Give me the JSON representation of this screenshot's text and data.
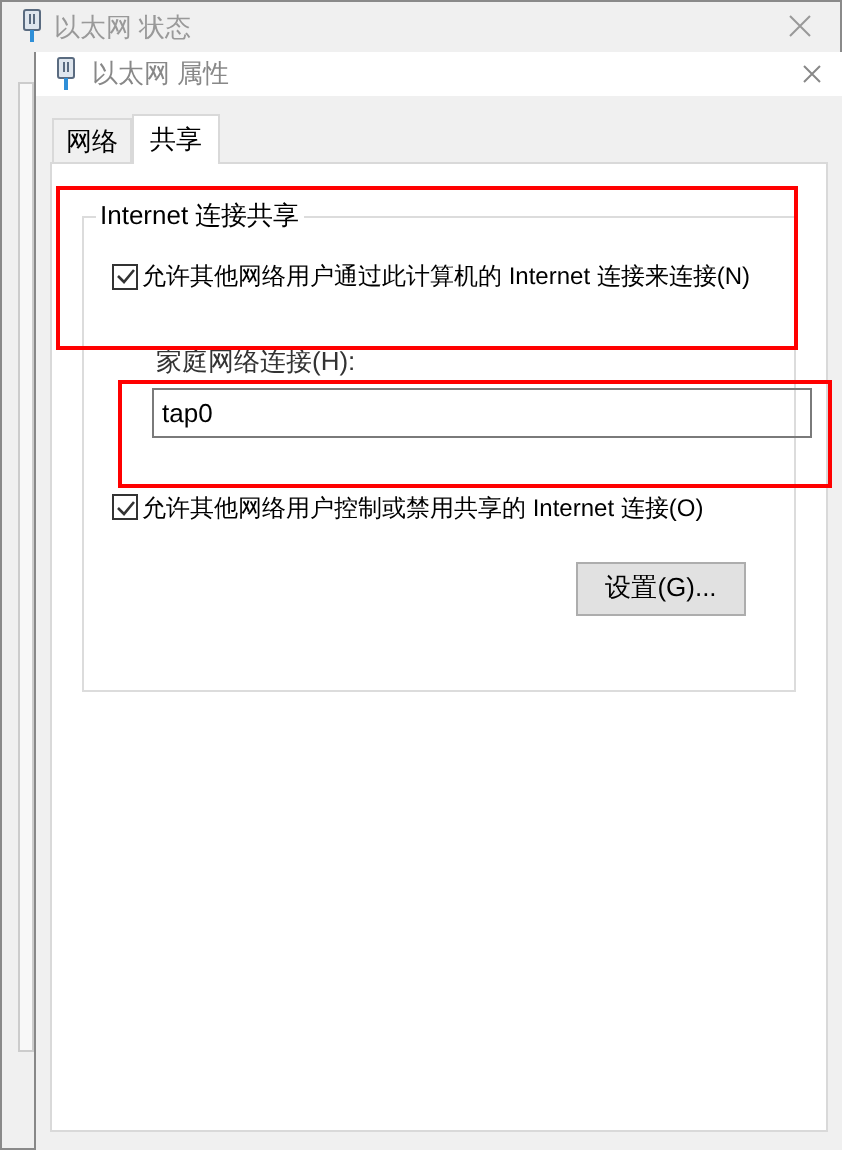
{
  "background_window": {
    "title": "以太网 状态"
  },
  "window": {
    "title": "以太网 属性"
  },
  "tabs": [
    {
      "label": "网络",
      "selected": false
    },
    {
      "label": "共享",
      "selected": true
    }
  ],
  "group": {
    "title": "Internet 连接共享",
    "allow_sharing": {
      "label": "允许其他网络用户通过此计算机的 Internet 连接来连接(N)",
      "checked": true
    },
    "home_network": {
      "label": "家庭网络连接(H):",
      "value": "tap0"
    },
    "allow_control": {
      "label": "允许其他网络用户控制或禁用共享的 Internet 连接(O)",
      "checked": true
    },
    "settings_button": "设置(G)..."
  }
}
